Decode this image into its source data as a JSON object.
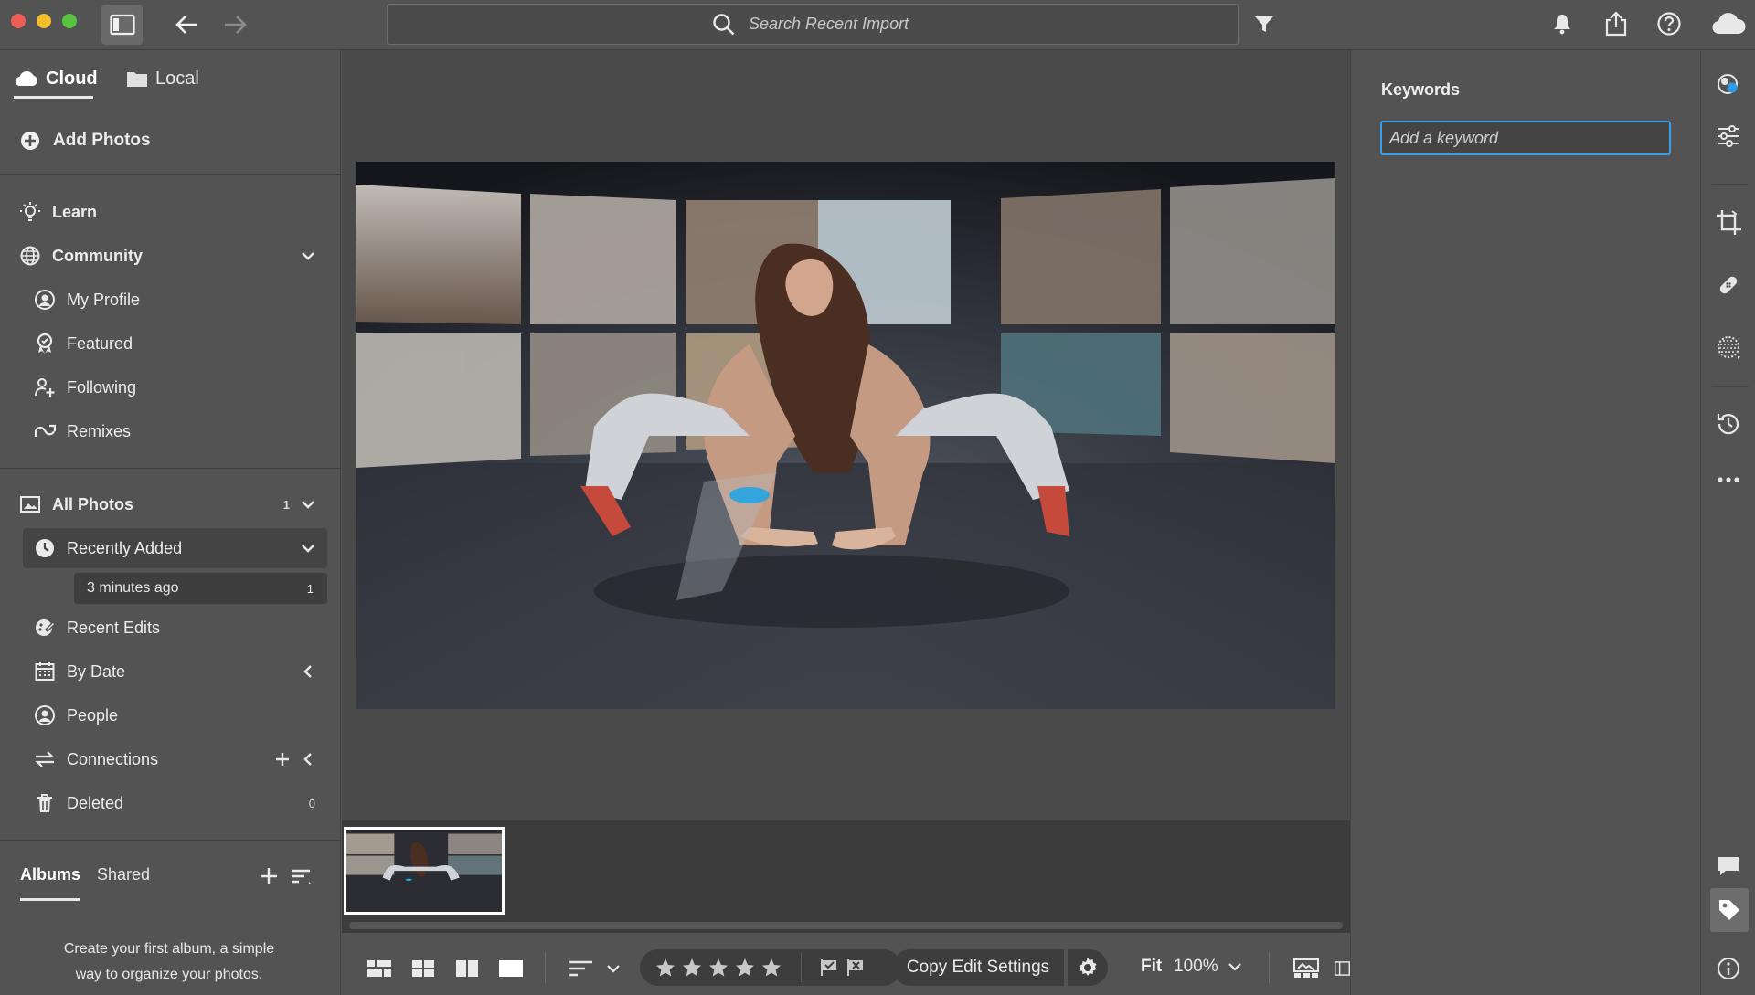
{
  "window": {
    "search_placeholder": "Search Recent Import"
  },
  "colors": {
    "accent": "#3a9ee8",
    "close": "#ee5e56",
    "minimize": "#f3bd2d",
    "zoom": "#58c33f"
  },
  "left_panel": {
    "source_tabs": {
      "cloud": "Cloud",
      "local": "Local"
    },
    "add_photos": "Add Photos",
    "learn": "Learn",
    "community": {
      "label": "Community",
      "items": [
        "My Profile",
        "Featured",
        "Following",
        "Remixes"
      ]
    },
    "library": {
      "all_photos": {
        "label": "All Photos",
        "count": "1"
      },
      "recently_added": {
        "label": "Recently Added",
        "sub_label": "3 minutes ago",
        "sub_count": "1"
      },
      "recent_edits": "Recent Edits",
      "by_date": "By Date",
      "people": "People",
      "connections": "Connections",
      "deleted": {
        "label": "Deleted",
        "count": "0"
      }
    },
    "albums": {
      "tab_albums": "Albums",
      "tab_shared": "Shared",
      "empty_line1": "Create your first album, a simple",
      "empty_line2": "way to organize your photos."
    }
  },
  "bottom_bar": {
    "copy_edit_settings": "Copy Edit Settings",
    "fit": "Fit",
    "zoom": "100%",
    "rating_stars": 5
  },
  "right_panel": {
    "keywords_title": "Keywords",
    "keyword_placeholder": "Add a keyword"
  }
}
